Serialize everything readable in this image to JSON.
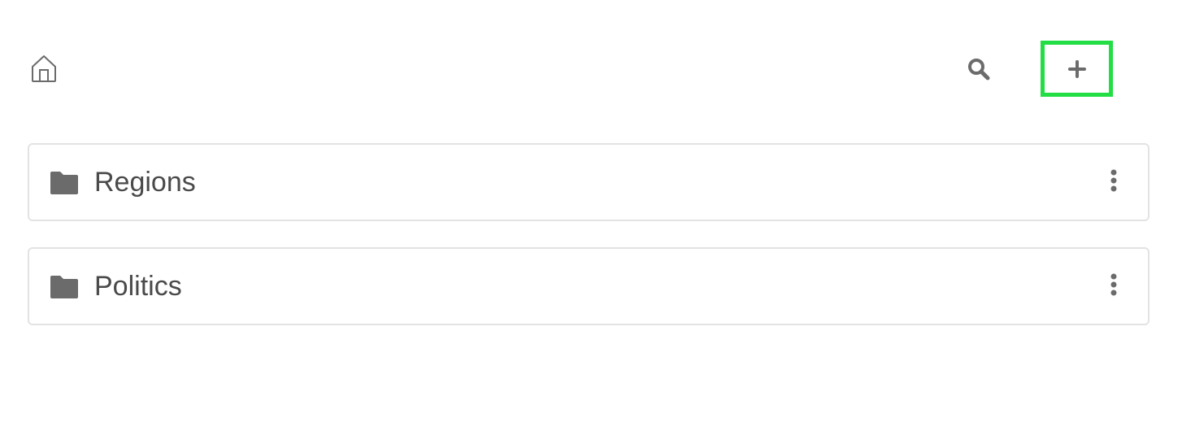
{
  "toolbar": {
    "icons": {
      "home": "home-icon",
      "search": "search-icon",
      "add": "plus-icon"
    },
    "highlight_color": "#22dd44",
    "icon_color": "#6b6b6b"
  },
  "folders": [
    {
      "label": "Regions",
      "icon": "folder-icon",
      "menu_icon": "more-vertical-icon"
    },
    {
      "label": "Politics",
      "icon": "folder-icon",
      "menu_icon": "more-vertical-icon"
    }
  ]
}
